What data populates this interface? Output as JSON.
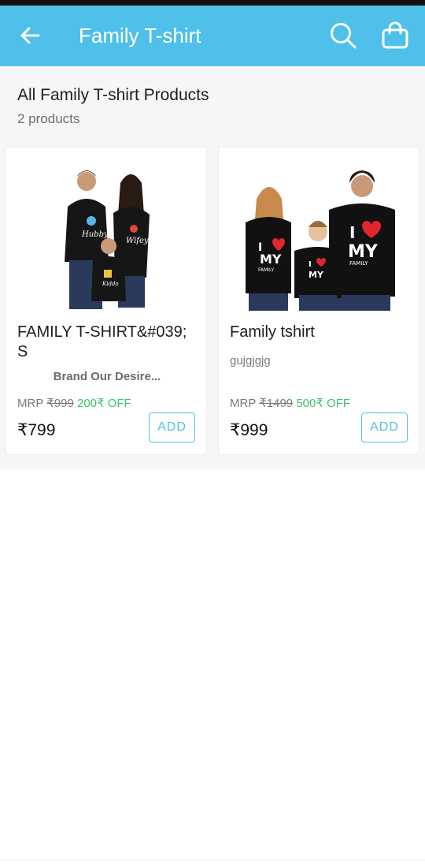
{
  "header": {
    "title": "Family T-shirt",
    "icons": [
      "back-arrow-icon",
      "search-icon",
      "shopping-bag-icon"
    ],
    "color": "#4ec0e9"
  },
  "listing": {
    "heading": "All Family T-shirt Products",
    "count": "2 products"
  },
  "products": [
    {
      "name": "FAMILY T-SHIRT&#039;S",
      "brand": "Brand Our Desire...",
      "mrp_label": "MRP",
      "mrp": "₹999",
      "discount": "200₹ OFF",
      "price": "₹799",
      "add_label": "ADD"
    },
    {
      "name": "Family tshirt",
      "subtitle": "gujgjgjg",
      "mrp_label": "MRP",
      "mrp": "₹1499",
      "discount": "500₹ OFF",
      "price": "₹999",
      "add_label": "ADD"
    }
  ],
  "colors": {
    "accent": "#4ec0e9",
    "discount": "#3cc36a"
  }
}
